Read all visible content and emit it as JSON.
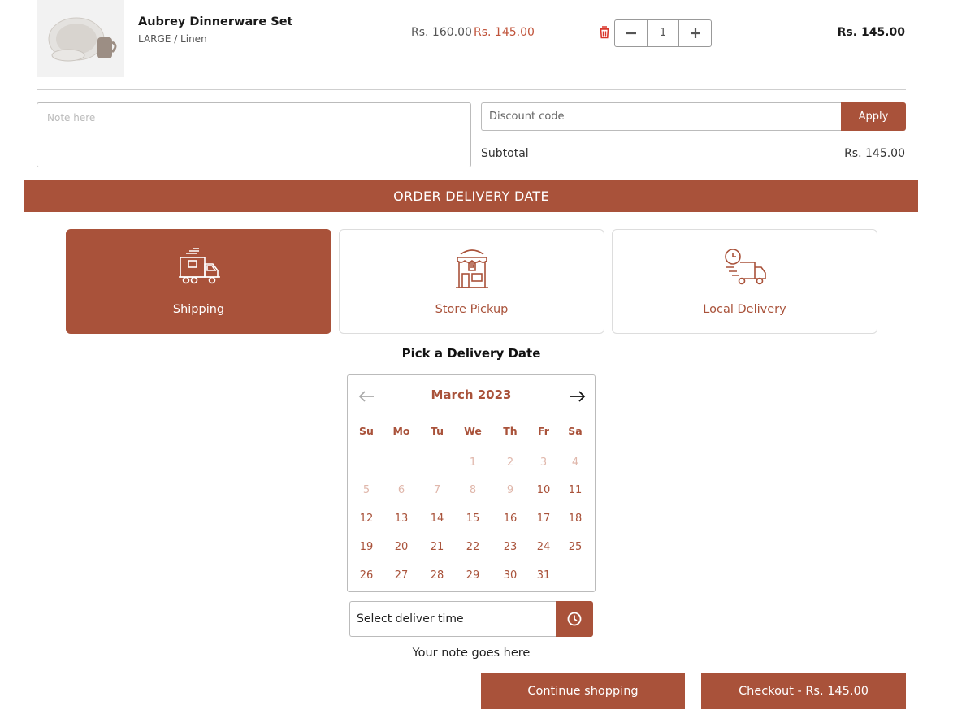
{
  "cart": {
    "item": {
      "name": "Aubrey Dinnerware Set",
      "variant": "LARGE / Linen",
      "compare_price": "Rs. 160.00",
      "price": "Rs. 145.00",
      "quantity": "1",
      "line_total": "Rs. 145.00",
      "image_icon": "dinnerware-image"
    },
    "note_placeholder": "Note here",
    "discount_placeholder": "Discount code",
    "apply_label": "Apply",
    "subtotal_label": "Subtotal",
    "subtotal_value": "Rs. 145.00"
  },
  "delivery": {
    "banner": "ORDER DELIVERY DATE",
    "options": [
      {
        "label": "Shipping",
        "icon": "shipping-truck-icon",
        "selected": true
      },
      {
        "label": "Store Pickup",
        "icon": "store-icon",
        "selected": false
      },
      {
        "label": "Local Delivery",
        "icon": "delivery-truck-clock-icon",
        "selected": false
      }
    ],
    "pick_title": "Pick a Delivery Date",
    "calendar": {
      "month_label": "March 2023",
      "weekdays": [
        "Su",
        "Mo",
        "Tu",
        "We",
        "Th",
        "Fr",
        "Sa"
      ],
      "first_weekday_index": 3,
      "days_in_month": 31,
      "disabled_through": 9
    },
    "time_placeholder": "Select deliver time",
    "note_text": "Your note goes here"
  },
  "actions": {
    "continue_label": "Continue shopping",
    "checkout_label": "Checkout - Rs. 145.00"
  },
  "colors": {
    "accent": "#a9523a",
    "disabled_day": "#e0b7ab",
    "price_sale": "#c0533a",
    "trash": "#d9362b"
  }
}
